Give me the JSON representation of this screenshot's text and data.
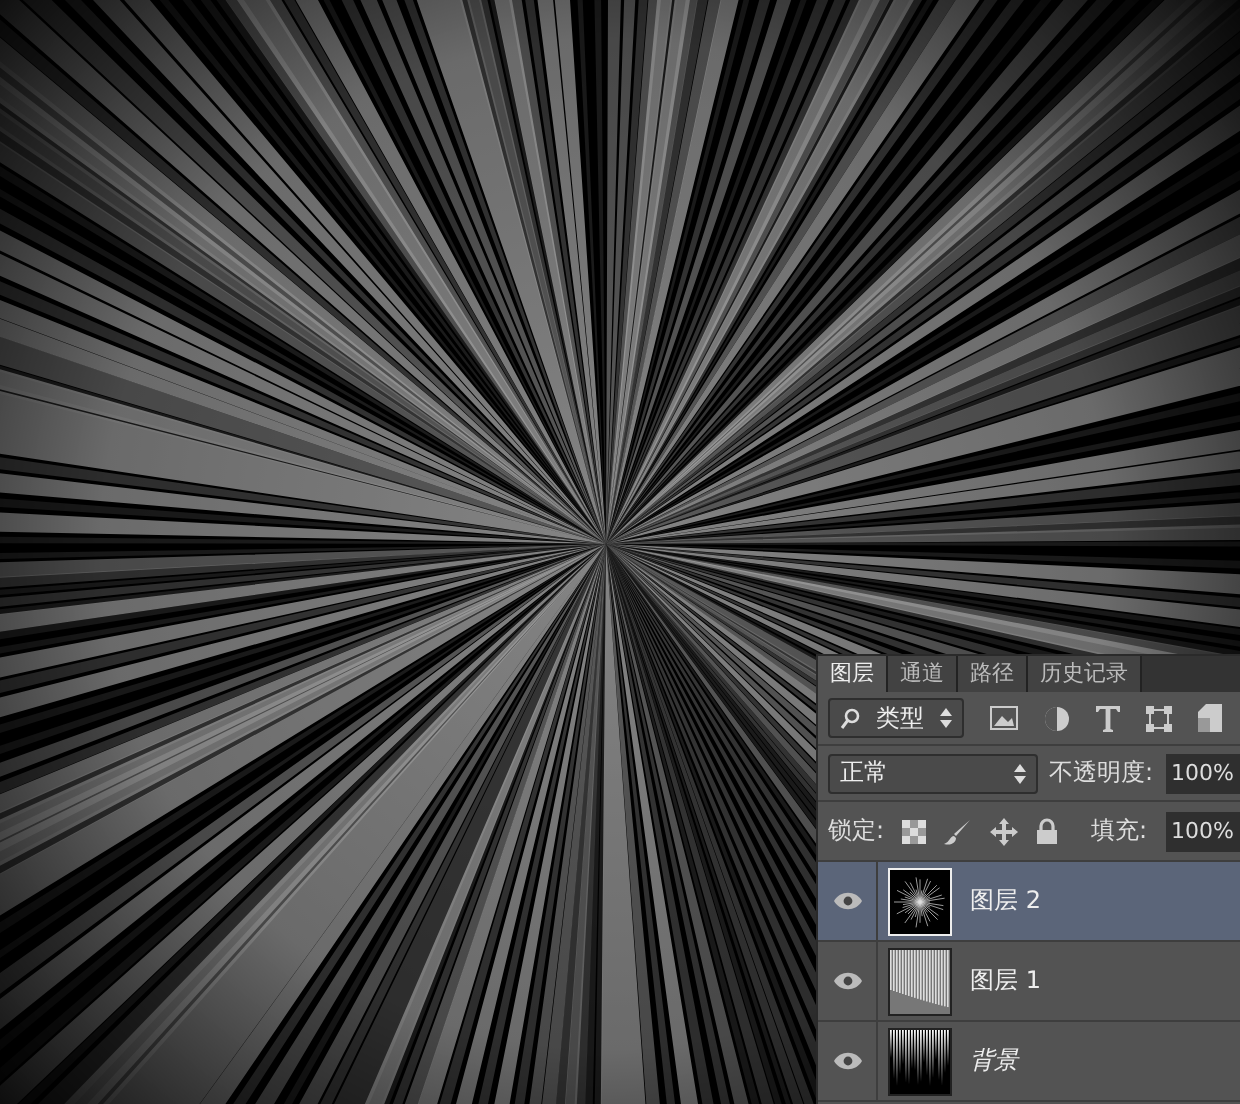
{
  "tabs": [
    {
      "label": "图层",
      "selected": true
    },
    {
      "label": "通道",
      "selected": false
    },
    {
      "label": "路径",
      "selected": false
    },
    {
      "label": "历史记录",
      "selected": false
    }
  ],
  "filter": {
    "value": "类型"
  },
  "blend_mode": {
    "value": "正常"
  },
  "opacity": {
    "label": "不透明度:",
    "value": "100%"
  },
  "lock": {
    "label": "锁定:"
  },
  "fill": {
    "label": "填充:",
    "value": "100%"
  },
  "layers": [
    {
      "name": "图层 2",
      "kind": "burst",
      "selected": true,
      "visible": true
    },
    {
      "name": "图层 1",
      "kind": "streaks",
      "selected": false,
      "visible": true
    },
    {
      "name": "背景",
      "kind": "background",
      "selected": false,
      "visible": true
    }
  ]
}
